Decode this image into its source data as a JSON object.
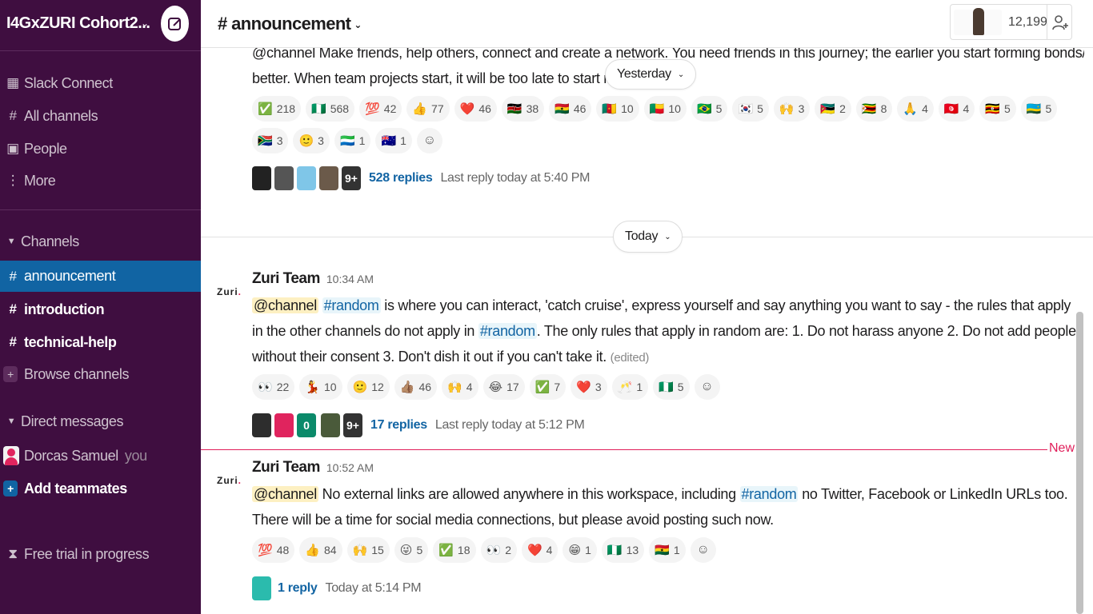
{
  "workspace": {
    "name": "I4GxZURI Cohort2..."
  },
  "sidebar": {
    "nav": [
      {
        "label": "Slack Connect",
        "icon": "building-icon"
      },
      {
        "label": "All channels",
        "icon": "channels-icon"
      },
      {
        "label": "People",
        "icon": "people-icon"
      },
      {
        "label": "More",
        "icon": "more-vertical-icon"
      }
    ],
    "channels_header": "Channels",
    "channels": [
      {
        "label": "announcement",
        "active": true
      },
      {
        "label": "introduction",
        "unread": true
      },
      {
        "label": "technical-help",
        "unread": true
      }
    ],
    "browse_channels": "Browse channels",
    "dm_header": "Direct messages",
    "dm_user": "Dorcas Samuel",
    "dm_you": "you",
    "add_teammates": "Add teammates",
    "trial": "Free trial in progress"
  },
  "header": {
    "channel_title": "# announcement",
    "member_count": "12,199"
  },
  "feed": {
    "msg0": {
      "line1": "@channel Make friends, help others, connect and create a network. You need friends in this journey; the earlier you start forming bonds/connections, the",
      "line2": "better. When team projects start, it will be too late to start making f",
      "reactions": [
        {
          "emoji": "✅",
          "count": "218"
        },
        {
          "emoji": "🇳🇬",
          "count": "568"
        },
        {
          "emoji": "💯",
          "count": "42"
        },
        {
          "emoji": "👍",
          "count": "77"
        },
        {
          "emoji": "❤️",
          "count": "46"
        },
        {
          "emoji": "🇰🇪",
          "count": "38"
        },
        {
          "emoji": "🇬🇭",
          "count": "46"
        },
        {
          "emoji": "🇨🇲",
          "count": "10"
        },
        {
          "emoji": "🇧🇯",
          "count": "10"
        },
        {
          "emoji": "🇧🇷",
          "count": "5"
        },
        {
          "emoji": "🇰🇷",
          "count": "5"
        },
        {
          "emoji": "🙌",
          "count": "3"
        },
        {
          "emoji": "🇲🇿",
          "count": "2"
        },
        {
          "emoji": "🇿🇼",
          "count": "8"
        },
        {
          "emoji": "🙏",
          "count": "4"
        },
        {
          "emoji": "🇹🇳",
          "count": "4"
        },
        {
          "emoji": "🇺🇬",
          "count": "5"
        },
        {
          "emoji": "🇷🇼",
          "count": "5"
        },
        {
          "emoji": "🇿🇦",
          "count": "3"
        },
        {
          "emoji": "🙂",
          "count": "3"
        },
        {
          "emoji": "🇸🇱",
          "count": "1"
        },
        {
          "emoji": "🇦🇺",
          "count": "1"
        }
      ],
      "more_avatars": "9+",
      "replies": "528 replies",
      "last_reply": "Last reply today at 5:40 PM"
    },
    "yesterday_label": "Yesterday",
    "today_label": "Today",
    "msg1": {
      "sender": "Zuri Team",
      "time": "10:34 AM",
      "mention": "@channel",
      "channel_ref": "#random",
      "text_a": "is where you can interact, 'catch cruise', express yourself and say anything you want to say - the rules that apply in the other channels",
      "text_b": "do not apply in",
      "text_c": ". The only rules that apply in random are: 1. Do not harass anyone 2. Do not add people without their consent 3. Don't dish it out if",
      "text_d": "you can't take it.",
      "edited": "(edited)",
      "reactions": [
        {
          "emoji": "👀",
          "count": "22"
        },
        {
          "emoji": "💃",
          "count": "10"
        },
        {
          "emoji": "🙂",
          "count": "12"
        },
        {
          "emoji": "👍🏽",
          "count": "46"
        },
        {
          "emoji": "🙌",
          "count": "4"
        },
        {
          "emoji": "😂",
          "count": "17"
        },
        {
          "emoji": "✅",
          "count": "7"
        },
        {
          "emoji": "❤️",
          "count": "3"
        },
        {
          "emoji": "🥂",
          "count": "1"
        },
        {
          "emoji": "🇳🇬",
          "count": "5"
        }
      ],
      "avatar_zero": "0",
      "more_avatars": "9+",
      "replies": "17 replies",
      "last_reply": "Last reply today at 5:12 PM"
    },
    "new_label": "New",
    "msg2": {
      "sender": "Zuri Team",
      "time": "10:52 AM",
      "mention": "@channel",
      "text_a": "No external links are allowed anywhere in this workspace, including",
      "channel_ref": "#random",
      "text_b": "no Twitter, Facebook or LinkedIn URLs too. There will be a time for",
      "text_c": "social media connections, but please avoid posting such now.",
      "reactions": [
        {
          "emoji": "💯",
          "count": "48"
        },
        {
          "emoji": "👍",
          "count": "84"
        },
        {
          "emoji": "🙌",
          "count": "15"
        },
        {
          "emoji": "😜",
          "count": "5"
        },
        {
          "emoji": "✅",
          "count": "18"
        },
        {
          "emoji": "👀",
          "count": "2"
        },
        {
          "emoji": "❤️",
          "count": "4"
        },
        {
          "emoji": "😁",
          "count": "1"
        },
        {
          "emoji": "🇳🇬",
          "count": "13"
        },
        {
          "emoji": "🇬🇭",
          "count": "1"
        }
      ],
      "replies": "1 reply",
      "last_reply": "Today at 5:14 PM"
    },
    "logo_text": "Zuri",
    "logo_dot": "."
  },
  "colors": {
    "sidebar_bg": "#3f0e40",
    "active_channel": "#1164a3",
    "link": "#1264a3",
    "new_line": "#e01e5a",
    "mention_bg": "#fdf0c2"
  }
}
